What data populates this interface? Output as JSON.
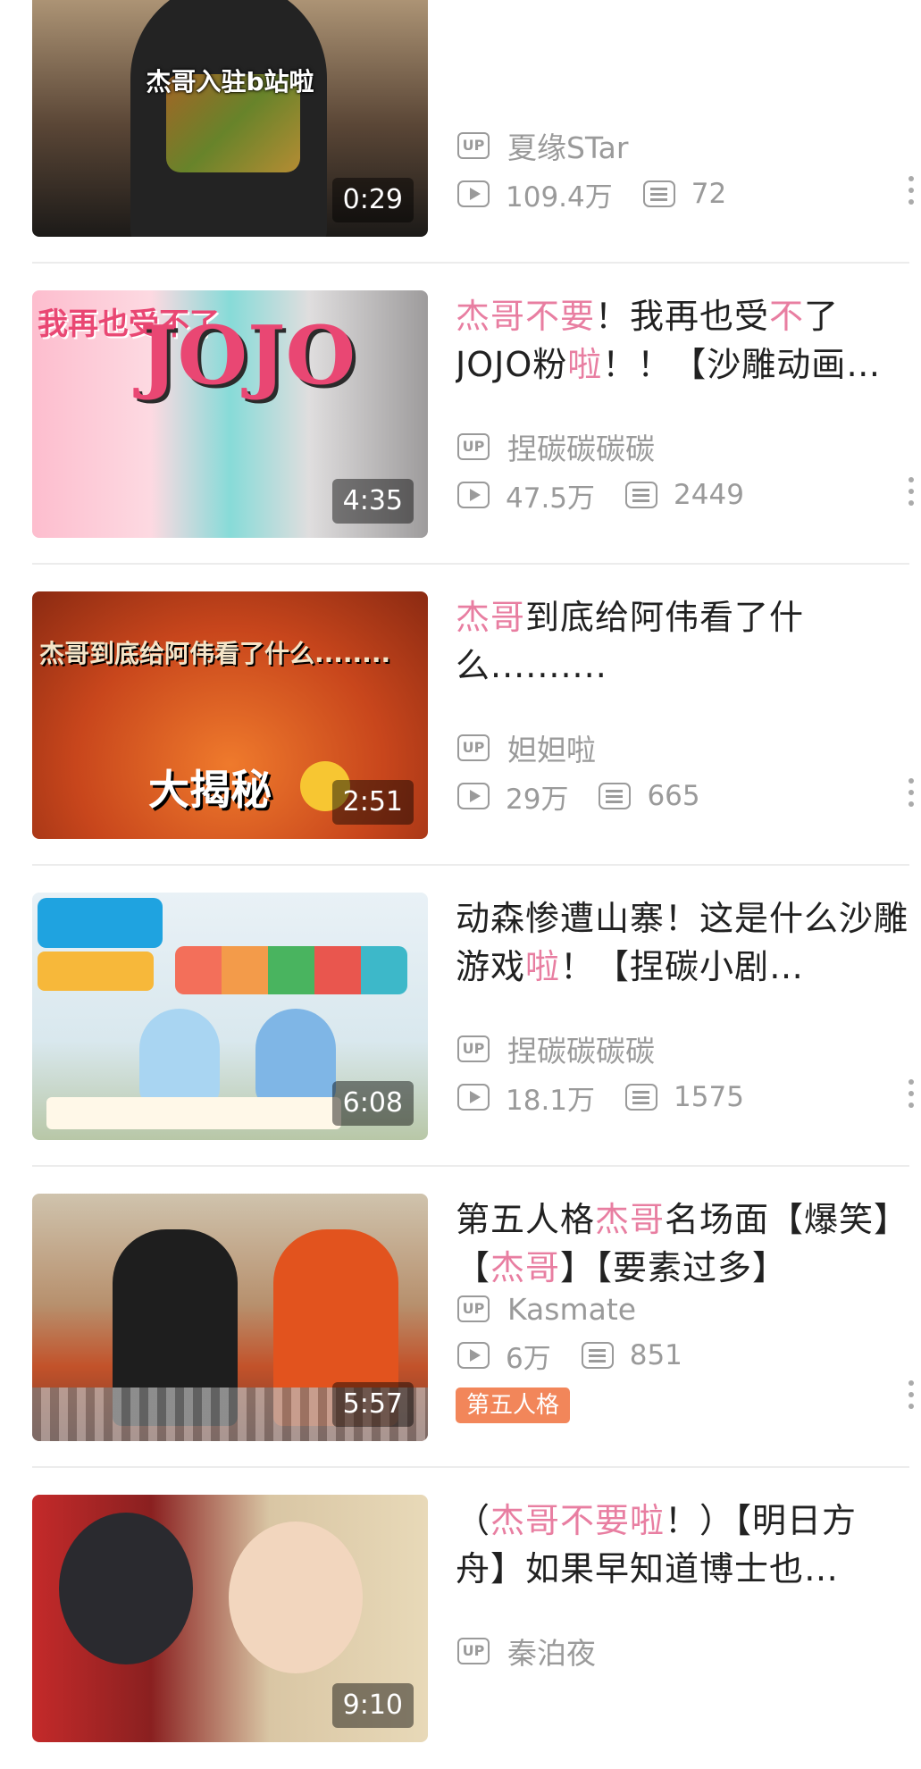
{
  "videos": [
    {
      "thumb_caption": "杰哥入驻b站啦",
      "duration": "0:29",
      "title_parts": [],
      "owner": "夏缘STar",
      "views": "109.4万",
      "danmaku": "72",
      "tag": ""
    },
    {
      "thumb_caption": "",
      "thumb_text_top": "我再也受不了",
      "thumb_logo": "JOJO",
      "duration": "4:35",
      "title_parts": [
        {
          "t": "杰哥不要",
          "hl": true
        },
        {
          "t": "！我再也受",
          "hl": false
        },
        {
          "t": "不",
          "hl": true
        },
        {
          "t": "了JOJO粉",
          "hl": false
        },
        {
          "t": "啦",
          "hl": true
        },
        {
          "t": "！！【沙雕动画…",
          "hl": false
        }
      ],
      "owner": "捏碳碳碳碳",
      "views": "47.5万",
      "danmaku": "2449",
      "tag": ""
    },
    {
      "thumb_text_line1": "杰哥到底给阿伟看了什么........",
      "thumb_text_line2": "大揭秘",
      "duration": "2:51",
      "title_parts": [
        {
          "t": "杰哥",
          "hl": true
        },
        {
          "t": "到底给阿伟看了什么..........",
          "hl": false
        }
      ],
      "owner": "妲妲啦",
      "views": "29万",
      "danmaku": "665",
      "tag": ""
    },
    {
      "duration": "6:08",
      "title_parts": [
        {
          "t": "动森惨遭山寨！这是什么沙雕游戏",
          "hl": false
        },
        {
          "t": "啦",
          "hl": true
        },
        {
          "t": "！【捏碳小剧…",
          "hl": false
        }
      ],
      "owner": "捏碳碳碳碳",
      "views": "18.1万",
      "danmaku": "1575",
      "tag": ""
    },
    {
      "duration": "5:57",
      "title_parts": [
        {
          "t": "第五人格",
          "hl": false
        },
        {
          "t": "杰哥",
          "hl": true
        },
        {
          "t": "名场面【爆笑】【",
          "hl": false
        },
        {
          "t": "杰哥",
          "hl": true
        },
        {
          "t": "】【要素过多】",
          "hl": false
        }
      ],
      "owner": "Kasmate",
      "views": "6万",
      "danmaku": "851",
      "tag": "第五人格"
    },
    {
      "duration": "9:10",
      "title_parts": [
        {
          "t": "（",
          "hl": false
        },
        {
          "t": "杰哥不要啦",
          "hl": true
        },
        {
          "t": "！）【明日方舟】如果早知道博士也…",
          "hl": false
        }
      ],
      "owner": "秦泊夜",
      "views": "",
      "danmaku": "",
      "tag": ""
    }
  ],
  "icons": {
    "up": "UP",
    "play": "play-count-icon",
    "danmaku": "danmaku-count-icon",
    "more": "more-vertical-icon"
  },
  "colors": {
    "highlight": "#e87ea1",
    "meta_gray": "#9a9a9a",
    "tag_orange": "#f2865a"
  }
}
